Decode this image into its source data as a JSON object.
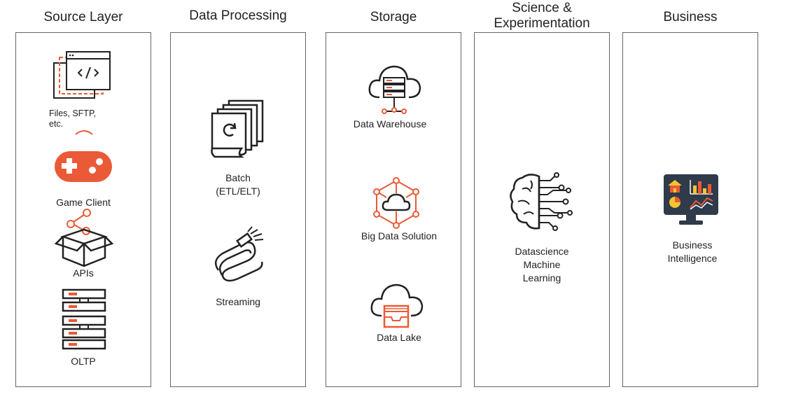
{
  "columns": [
    {
      "title": "Source Layer",
      "items": [
        {
          "label": "Files, SFTP, etc.",
          "icon": "code-files-icon"
        },
        {
          "label": "Game Client",
          "icon": "gamepad-icon"
        },
        {
          "label": "APIs",
          "icon": "api-box-icon"
        },
        {
          "label": "OLTP",
          "icon": "server-stack-icon"
        }
      ]
    },
    {
      "title": "Data Processing",
      "items": [
        {
          "label": "Batch\n(ETL/ELT)",
          "icon": "batch-pages-icon"
        },
        {
          "label": "Streaming",
          "icon": "stream-hose-icon"
        }
      ]
    },
    {
      "title": "Storage",
      "items": [
        {
          "label": "Data Warehouse",
          "icon": "cloud-server-icon"
        },
        {
          "label": "Big Data Solution",
          "icon": "cloud-network-icon"
        },
        {
          "label": "Data Lake",
          "icon": "cloud-tray-icon"
        }
      ]
    },
    {
      "title": "Science &\nExperimentation",
      "items": [
        {
          "label": "Datascience\nMachine\nLearning",
          "icon": "brain-circuit-icon"
        }
      ]
    },
    {
      "title": "Business",
      "items": [
        {
          "label": "Business\nIntelligence",
          "icon": "bi-dashboard-icon"
        }
      ]
    }
  ],
  "colors": {
    "accent": "#ea5a36",
    "line": "#222222",
    "border": "#666666",
    "monitor": "#2f3a4a"
  }
}
